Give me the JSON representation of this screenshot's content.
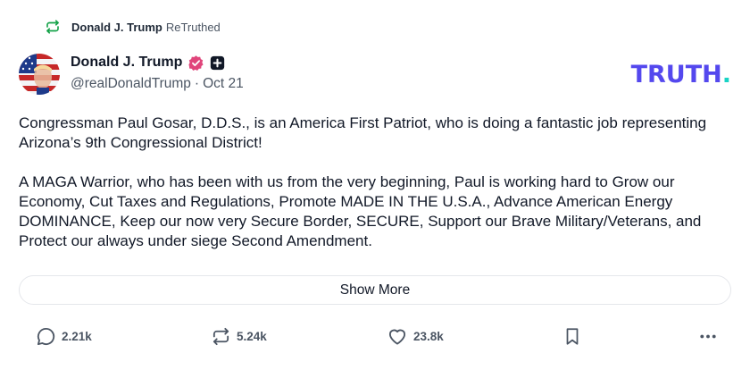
{
  "retruth": {
    "name": "Donald J. Trump",
    "label": "ReTruthed"
  },
  "author": {
    "display_name": "Donald J. Trump",
    "handle": "@realDonaldTrump",
    "separator": "·",
    "date": "Oct 21"
  },
  "brand": {
    "text": "TRUTH",
    "dot": ".",
    "color": "#5448ee",
    "dot_color": "#19d3c5"
  },
  "post": {
    "paragraphs": [
      "Congressman Paul Gosar, D.D.S., is an America First Patriot, who is doing a fantastic job representing Arizona’s 9th Congressional District!",
      "A MAGA Warrior, who has been with us from the very beginning, Paul is working hard to Grow our Economy, Cut Taxes and Regulations, Promote MADE IN THE U.S.A., Advance American Energy DOMINANCE, Keep our now very Secure Border, SECURE, Support our Brave Military/Veterans, and Protect our always under siege Second Amendment."
    ]
  },
  "show_more_label": "Show More",
  "actions": {
    "replies": "2.21k",
    "retruths": "5.24k",
    "likes": "23.8k"
  },
  "icons": {
    "retruth": "retruth-icon",
    "verified": "verified-badge-icon",
    "follow": "plus-square-icon",
    "reply": "comment-bubble-icon",
    "repost": "retruth-arrows-icon",
    "like": "heart-icon",
    "bookmark": "bookmark-icon",
    "more": "more-dots-icon"
  },
  "colors": {
    "retruth_icon": "#16a34a",
    "verified": "#e0457b",
    "text": "#111827",
    "muted": "#4b5563"
  }
}
